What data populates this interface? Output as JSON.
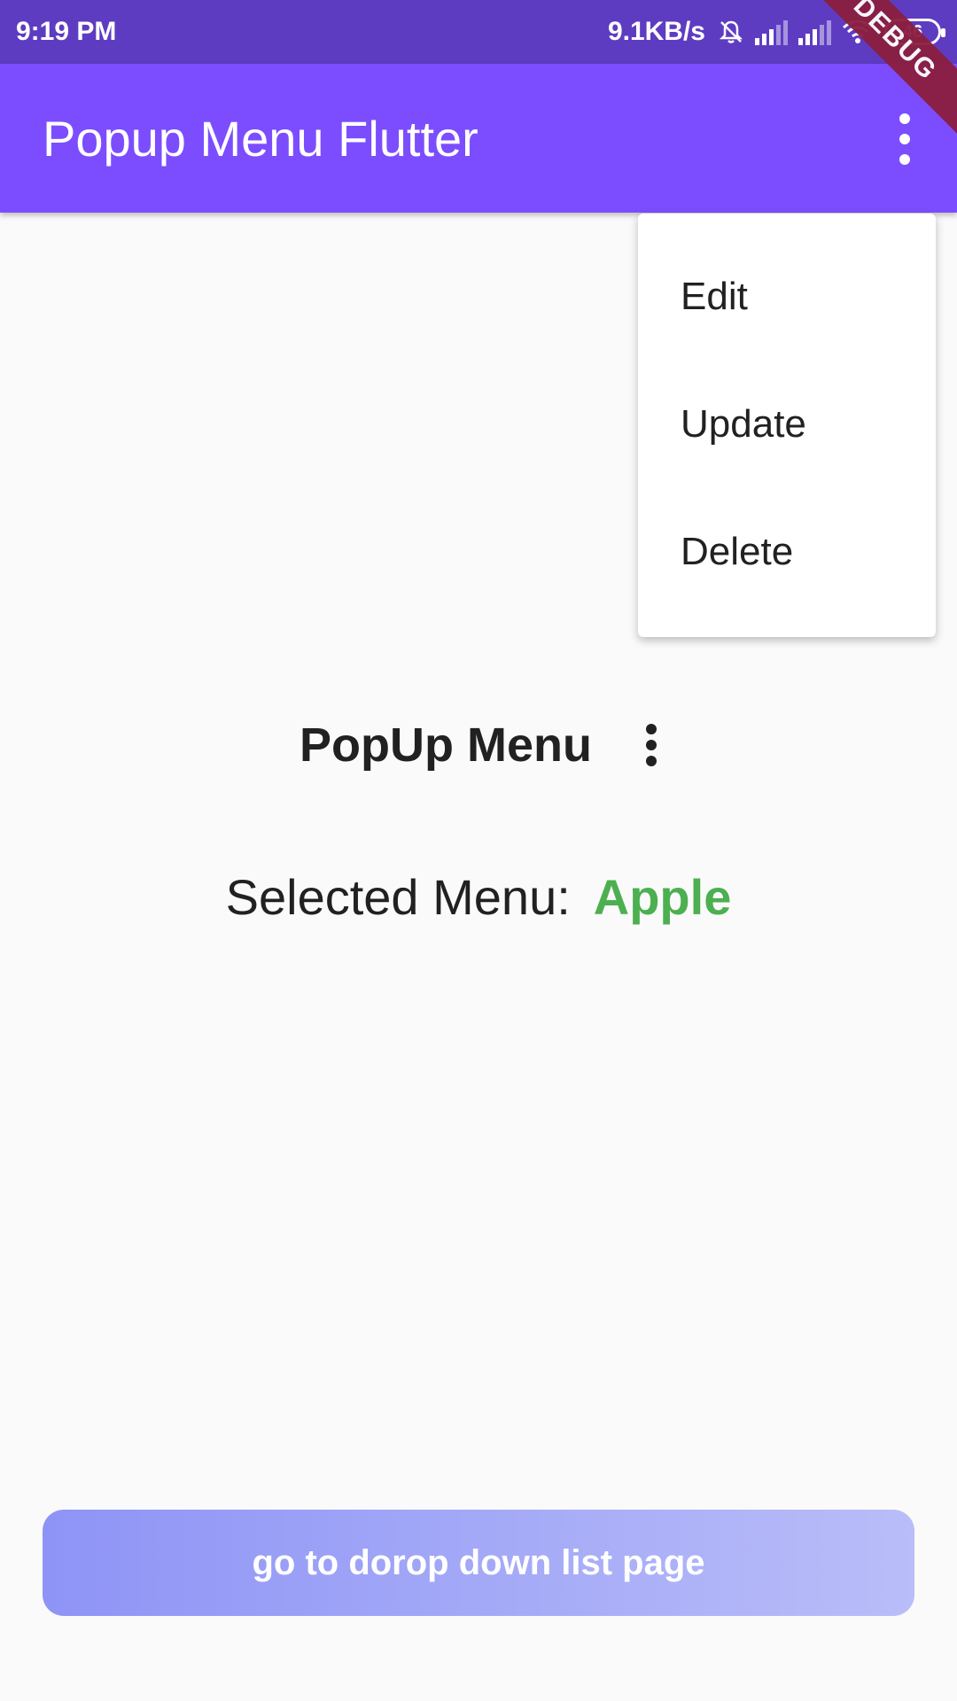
{
  "status_bar": {
    "time": "9:19 PM",
    "speed": "9.1KB/s",
    "battery": "46"
  },
  "app_bar": {
    "title": "Popup Menu Flutter",
    "debug_label": "DEBUG",
    "menu_icon": "more-vert-icon"
  },
  "popup_menu": {
    "items": [
      "Edit",
      "Update",
      "Delete"
    ]
  },
  "content": {
    "popup_label": "PopUp Menu",
    "selected_label": "Selected Menu:",
    "selected_value": "Apple"
  },
  "bottom_button": {
    "label": "go to dorop down list page"
  },
  "colors": {
    "status_bar": "#5e3cc2",
    "app_bar": "#7c4dff",
    "selected_value": "#4caf50",
    "debug_banner": "#8b1e3f"
  }
}
